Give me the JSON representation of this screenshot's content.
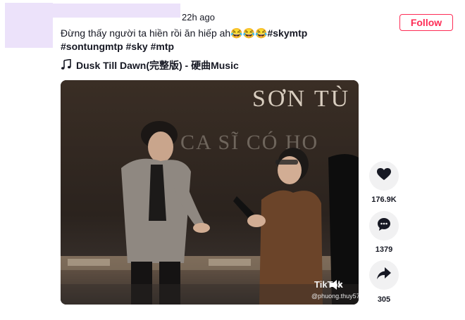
{
  "post": {
    "time": "22h ago",
    "follow_label": "Follow",
    "caption_text": "Đừng thấy người ta hiền rồi ăn hiếp ah😂😂😂",
    "hashtags_line1": "#skymtp",
    "hashtags_line2": "#sontungmtp #sky #mtp",
    "music_title": "Dusk Till Dawn(完整版) - 硬曲Music"
  },
  "video": {
    "stage_text_top": "SƠN TÙ",
    "stage_text_mid": "CA SĨ CÓ HO",
    "watermark": "TikTok",
    "watermark_handle": "@phuong.thuy57",
    "mute_icon": "speaker-muted-icon"
  },
  "actions": {
    "likes": "176.9K",
    "comments": "1379",
    "shares": "305"
  },
  "colors": {
    "accent": "#fe2c55",
    "button_bg": "#f1f1f2",
    "redaction": "#ece2fa"
  }
}
